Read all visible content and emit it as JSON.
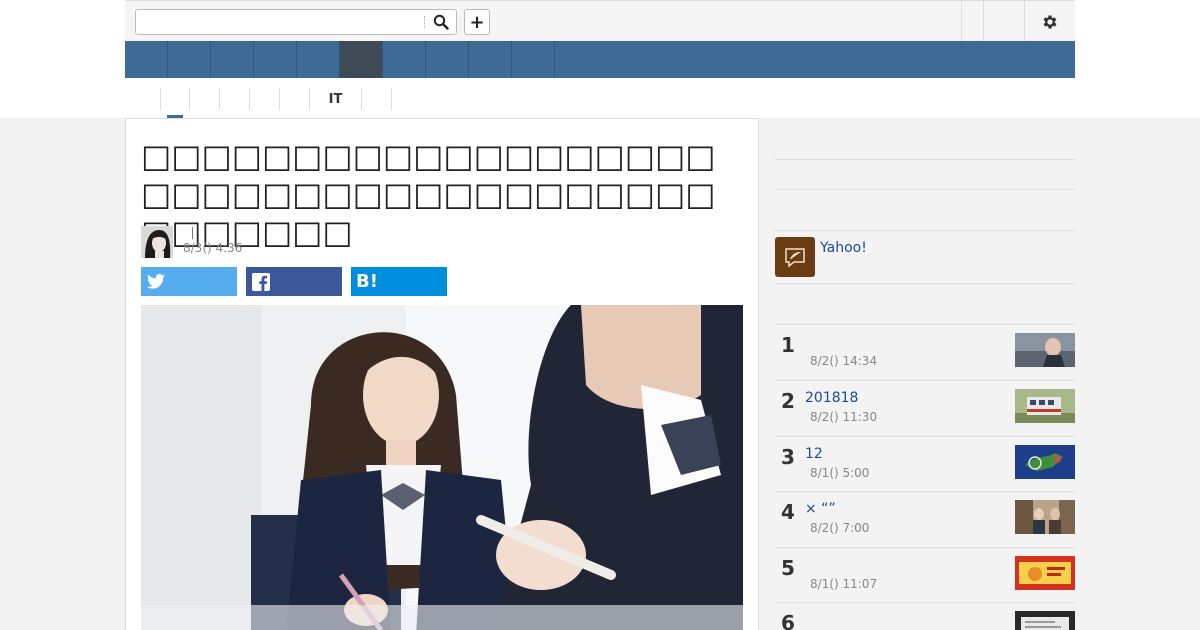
{
  "search": {
    "placeholder": "",
    "value": ""
  },
  "masthead": {
    "plus_label": "+"
  },
  "nav": {
    "items": [
      "",
      "",
      "",
      "",
      "",
      "",
      "",
      "",
      "",
      ""
    ],
    "active_index": 5
  },
  "subnav": {
    "items": [
      "",
      "",
      "",
      "",
      "",
      "IT",
      "",
      ""
    ],
    "active_index": 0
  },
  "article": {
    "title": "□□□□□□□□□□□□□□□□□□□□□□□□□□□□□□□□□□□□□□□□□□□□□",
    "author": "",
    "date": "8/3() 4:36",
    "share_hatena": "B!"
  },
  "sidebar": {
    "yahoo_label": "Yahoo!",
    "ranking": [
      {
        "num": "1",
        "title": "",
        "date": "8/2() 14:34",
        "thumb": "politician-photo"
      },
      {
        "num": "2",
        "title": "201818",
        "date": "8/2() 11:30",
        "thumb": "train-photo"
      },
      {
        "num": "3",
        "title": "12",
        "date": "8/1() 5:00",
        "thumb": "weather-map"
      },
      {
        "num": "4",
        "title": "× “”",
        "date": "8/2() 7:00",
        "thumb": "interview-photo"
      },
      {
        "num": "5",
        "title": "",
        "date": "8/1() 11:07",
        "thumb": "food-ad"
      },
      {
        "num": "6",
        "title": "",
        "date": "",
        "thumb": "document-photo"
      }
    ]
  },
  "colors": {
    "nav": "#3e6b95",
    "nav_active": "#3f4a57",
    "twitter": "#55acee",
    "facebook": "#3b5998",
    "hatena": "#008fde",
    "link": "#1a4b9b"
  }
}
